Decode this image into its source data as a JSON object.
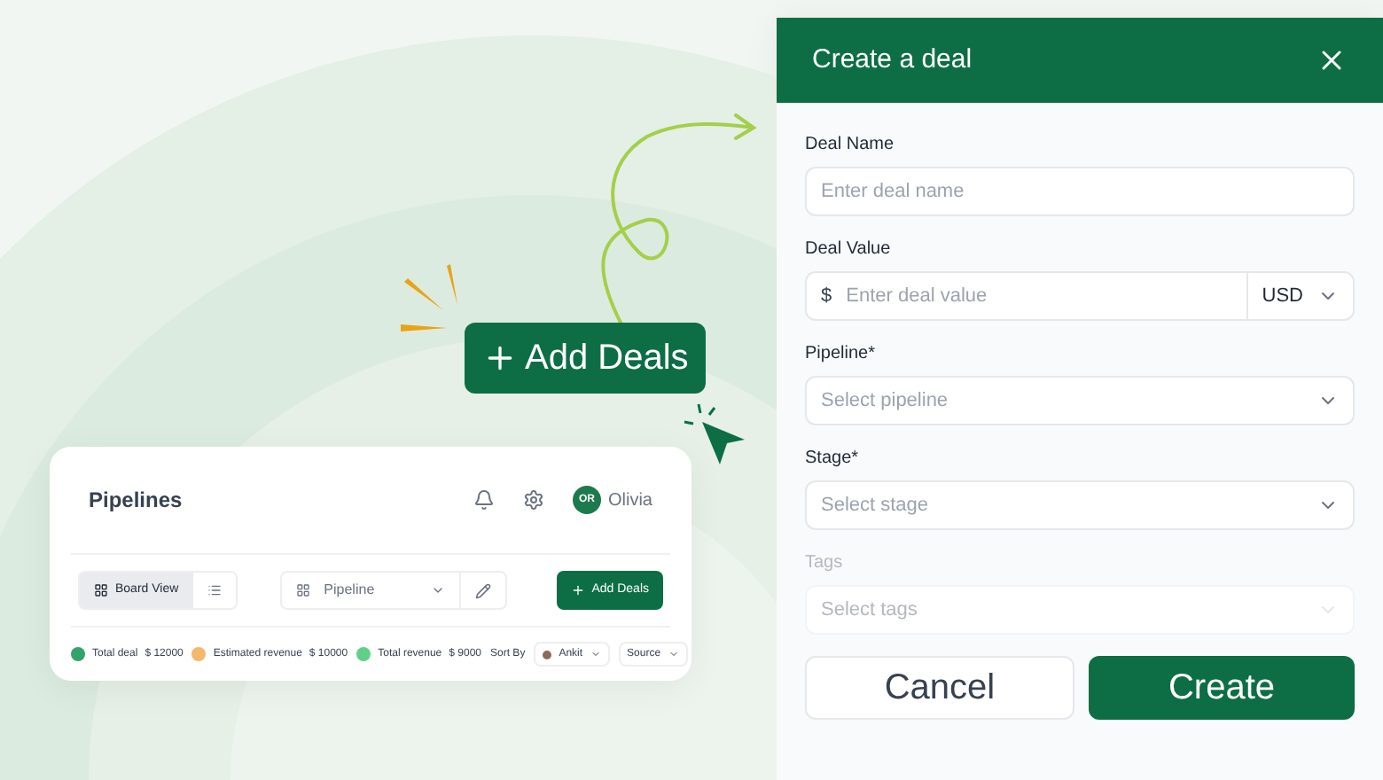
{
  "hero_button": {
    "label": "Add Deals"
  },
  "pipelines_card": {
    "title": "Pipelines",
    "user": {
      "initials": "OR",
      "name": "Olivia"
    },
    "views": [
      {
        "label": "Board View",
        "selected": true
      },
      {
        "selected": false
      }
    ],
    "pipeline_select": "Pipeline",
    "add_button": "Add Deals",
    "stats": [
      {
        "label": "Total deal",
        "value": "$ 12000",
        "color": "#34a36b"
      },
      {
        "label": "Estimated revenue",
        "value": "$ 10000",
        "color": "#f5b76a"
      },
      {
        "label": "Total revenue",
        "value": "$ 9000",
        "color": "#5fd08a"
      }
    ],
    "sort_label": "Sort By",
    "sort_user": "Ankit",
    "source": "Source"
  },
  "dialog": {
    "title": "Create a deal",
    "fields": [
      {
        "kind": "text",
        "label": "Deal Name",
        "placeholder": "Enter deal name"
      },
      {
        "kind": "money",
        "label": "Deal Value",
        "prefix": "$",
        "placeholder": "Enter deal value",
        "currency": "USD"
      },
      {
        "kind": "select",
        "label": "Pipeline*",
        "placeholder": "Select pipeline"
      },
      {
        "kind": "select",
        "label": "Stage*",
        "placeholder": "Select stage"
      },
      {
        "kind": "select",
        "label": "Tags",
        "placeholder": "Select tags",
        "disabled": true
      }
    ],
    "buttons": [
      {
        "kind": "secondary",
        "label": "Cancel"
      },
      {
        "kind": "primary",
        "label": "Create"
      }
    ]
  }
}
